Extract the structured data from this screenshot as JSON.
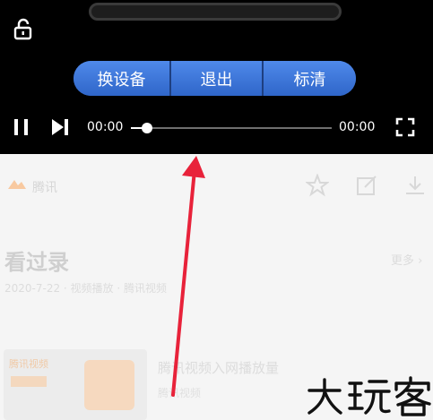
{
  "player": {
    "buttons": [
      {
        "label": "换设备"
      },
      {
        "label": "退出"
      },
      {
        "label": "标清"
      }
    ],
    "current_time": "00:00",
    "total_time": "00:00",
    "progress_fraction": 0.08,
    "accent_color": "#3d7ae0"
  },
  "content": {
    "app_name": "腾讯",
    "page_title": "看过录",
    "page_subtitle": "2020-7-22 · 视频播放 · 腾讯视频",
    "more_link": "更多 ›",
    "card_badge": "腾讯视频",
    "card_title": "腾讯视频入网播放量",
    "card_meta": "腾讯视频"
  },
  "icons": {
    "lock": "unlock-icon",
    "pause": "pause-icon",
    "next": "skip-next-icon",
    "fullscreen": "fullscreen-icon",
    "star": "star-icon",
    "edit": "edit-icon",
    "download": "download-icon"
  },
  "annotation_color": "#e8223a"
}
